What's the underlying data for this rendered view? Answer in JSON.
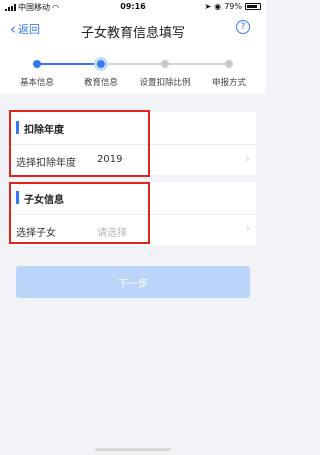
{
  "status_bar": {
    "carrier": "中国移动",
    "time": "09:16",
    "battery": "79%"
  },
  "nav": {
    "back_label": "返回",
    "title": "子女教育信息填写",
    "help_symbol": "?"
  },
  "steps": [
    {
      "label": "基本信息",
      "state": "done"
    },
    {
      "label": "教育信息",
      "state": "current"
    },
    {
      "label": "设置扣除比例",
      "state": "todo"
    },
    {
      "label": "申报方式",
      "state": "todo"
    }
  ],
  "deduction_year": {
    "section_title": "扣除年度",
    "field_label": "选择扣除年度",
    "value": "2019"
  },
  "child_info": {
    "section_title": "子女信息",
    "field_label": "选择子女",
    "placeholder": "请选择"
  },
  "next_button": {
    "label": "下一步"
  },
  "colors": {
    "accent": "#3478f6",
    "highlight_border": "#e0241d",
    "disabled_button": "#bcd4f8"
  },
  "icons": {
    "back": "chevron-left-icon",
    "help": "question-circle-icon",
    "row_arrow": "chevron-right-icon"
  }
}
